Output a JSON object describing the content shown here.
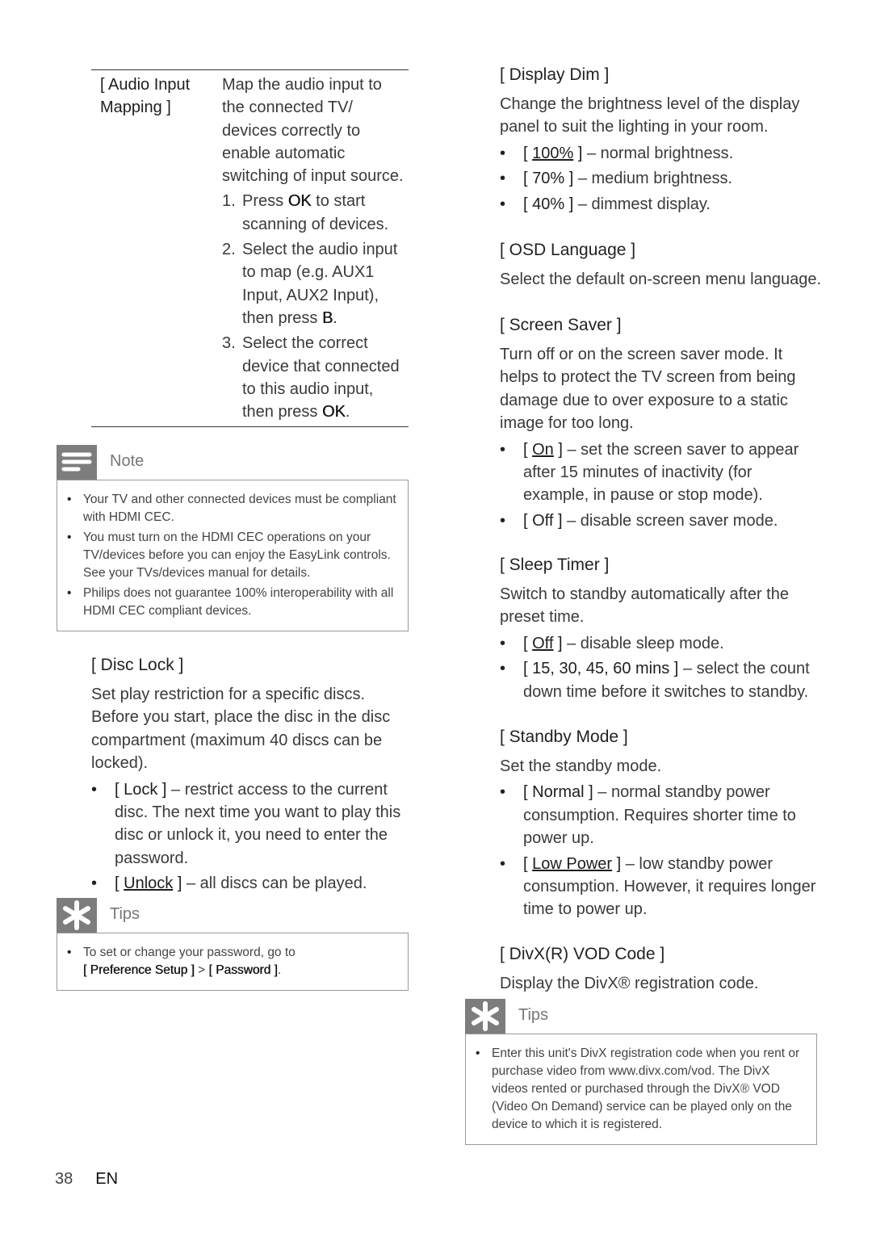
{
  "audio_mapping": {
    "label": "[ Audio Input Mapping ]",
    "description": "Map the audio input to the connected TV/ devices correctly to enable automatic switching of input source.",
    "steps": [
      {
        "num": "1.",
        "pre": "Press ",
        "bold": "OK",
        "post": " to start scanning of devices."
      },
      {
        "num": "2.",
        "pre": "Select the audio input to map (e.g. AUX1 Input, AUX2 Input), then press ",
        "bold": "B",
        "post": "."
      },
      {
        "num": "3.",
        "pre": "Select the correct device that connected to this audio input, then press ",
        "bold": "OK",
        "post": "."
      }
    ]
  },
  "note": {
    "title": "Note",
    "icon": "note-lines-icon",
    "items": [
      "Your TV and other connected devices must be compliant with HDMI CEC.",
      "You must turn on the HDMI CEC operations on your TV/devices before you can enjoy the EasyLink controls. See your TVs/devices manual for details.",
      "Philips does not guarantee 100% interoperability with all HDMI CEC compliant devices."
    ]
  },
  "disc_lock": {
    "heading": "[ Disc Lock ]",
    "description": "Set play restriction for a specific discs. Before you start, place the disc in the disc compartment (maximum 40 discs can be locked).",
    "options": [
      {
        "label": "Lock",
        "underline": false,
        "desc": " – restrict access to the current disc.  The next time you want to play this disc or unlock it, you need to enter the password."
      },
      {
        "label": "Unlock",
        "underline": true,
        "desc": " – all discs can be played."
      }
    ]
  },
  "tips1": {
    "title": "Tips",
    "icon": "asterisk-tips-icon",
    "text": "To set or change your password, go to",
    "path1": "[ Preference Setup ]",
    "sep": " > ",
    "path2": "[ Password ]",
    "end": "."
  },
  "display_dim": {
    "heading": "[ Display Dim ]",
    "description": "Change the brightness level of the display panel to suit the lighting in your room.",
    "options": [
      {
        "label": "100%",
        "underline": true,
        "desc": " – normal brightness."
      },
      {
        "label": "70%",
        "underline": false,
        "desc": " – medium brightness."
      },
      {
        "label": "40%",
        "underline": false,
        "desc": " – dimmest display."
      }
    ]
  },
  "osd_language": {
    "heading": "[ OSD Language ]",
    "description": "Select the default on-screen menu language."
  },
  "screen_saver": {
    "heading": "[ Screen Saver ]",
    "description": "Turn off or on the screen saver mode.  It helps to protect the TV screen from being damage due to over exposure to a static image for too long.",
    "options": [
      {
        "label": "On",
        "underline": true,
        "desc": " – set the screen saver to appear after 15 minutes of inactivity (for example, in pause or stop mode)."
      },
      {
        "label": "Off",
        "underline": false,
        "desc": " – disable screen saver mode."
      }
    ]
  },
  "sleep_timer": {
    "heading": "[ Sleep Timer ]",
    "description": "Switch to standby automatically after the preset time.",
    "options": [
      {
        "label": "Off",
        "underline": true,
        "desc": " – disable sleep mode."
      },
      {
        "label": "15, 30, 45, 60 mins",
        "underline": false,
        "desc": " – select the count down time before it switches to standby."
      }
    ]
  },
  "standby_mode": {
    "heading": "[ Standby Mode ]",
    "description": "Set the standby mode.",
    "options": [
      {
        "label": "Normal",
        "underline": false,
        "desc": " – normal standby power consumption. Requires shorter time to power up."
      },
      {
        "label": "Low Power",
        "underline": true,
        "desc": " – low standby power consumption. However, it requires longer time to power up."
      }
    ]
  },
  "divx": {
    "heading": "[ DivX(R) VOD Code ]",
    "description": "Display the DivX® registration code."
  },
  "tips2": {
    "title": "Tips",
    "icon": "asterisk-tips-icon",
    "text": "Enter this unit's DivX registration code when you rent or purchase video from www.divx.com/vod. The DivX videos rented or purchased through the DivX® VOD (Video On Demand) service can be played only on the device to which it is registered."
  },
  "footer": {
    "page": "38",
    "lang": "EN"
  }
}
